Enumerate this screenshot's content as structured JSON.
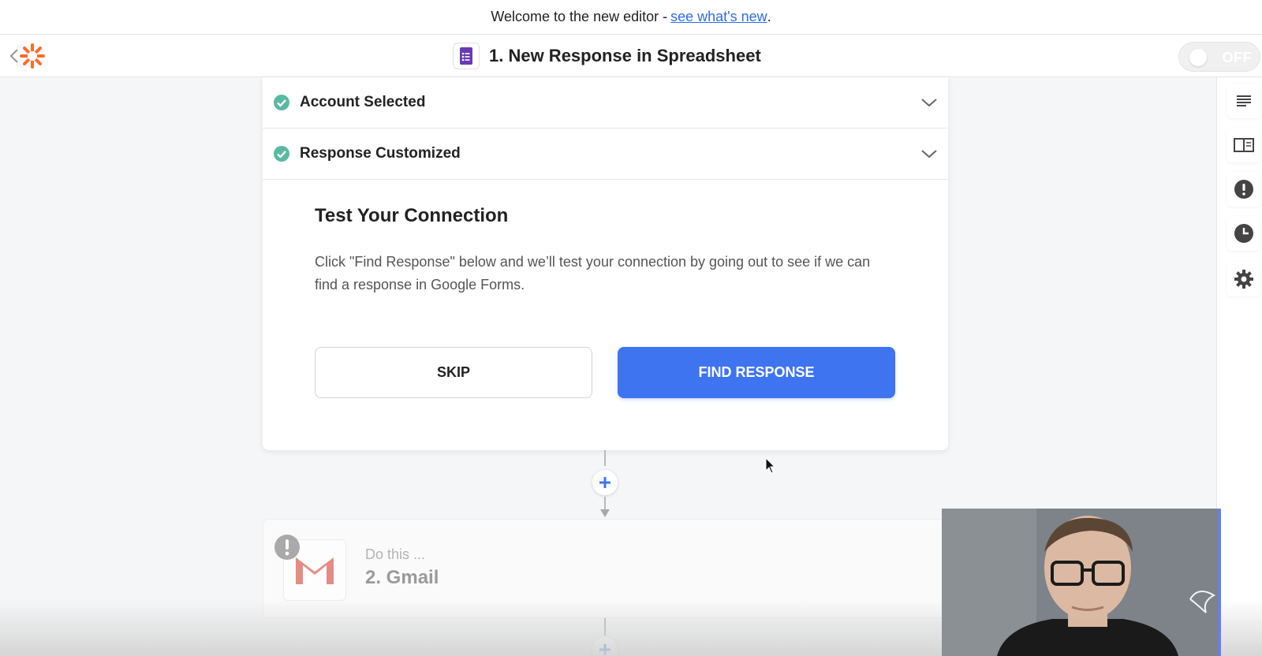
{
  "banner": {
    "text": "Welcome to the new editor -",
    "link_text": "see what's new",
    "period": "."
  },
  "header": {
    "zap_title": "1. New Response in Spreadsheet",
    "toggle_label": "OFF"
  },
  "sections": [
    {
      "label": "Account Selected",
      "status": "complete"
    },
    {
      "label": "Response Customized",
      "status": "complete"
    }
  ],
  "test_panel": {
    "title": "Test Your Connection",
    "description": "Click \"Find Response\" below and we’ll test your connection by going out to see if we can find a response in Google Forms.",
    "skip_label": "SKIP",
    "find_label": "FIND RESPONSE"
  },
  "next_step": {
    "subtitle": "Do this ...",
    "name": "2. Gmail"
  },
  "colors": {
    "accent": "#3f74f0",
    "brand": "#ff6a2a",
    "success": "#5ab9a3",
    "forms_purple": "#673ab7"
  },
  "icons": {
    "back": "chevron-left-icon",
    "logo": "asterisk-logo",
    "forms": "google-forms-icon",
    "rail": [
      "notes-icon",
      "book-icon",
      "alert-icon",
      "clock-icon",
      "gear-icon"
    ]
  }
}
